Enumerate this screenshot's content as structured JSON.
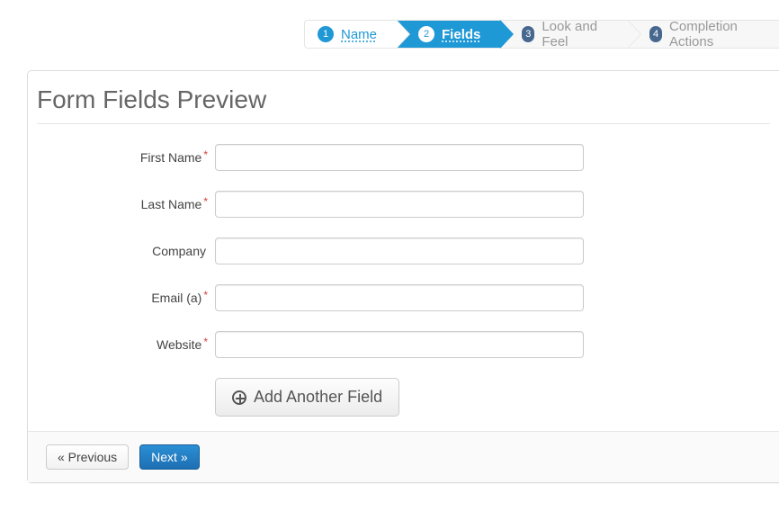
{
  "wizard": {
    "steps": [
      {
        "num": "1",
        "label": "Name"
      },
      {
        "num": "2",
        "label": "Fields"
      },
      {
        "num": "3",
        "label": "Look and Feel"
      },
      {
        "num": "4",
        "label": "Completion Actions"
      }
    ]
  },
  "panel": {
    "title": "Form Fields Preview"
  },
  "fields": [
    {
      "label": "First Name",
      "required": true,
      "value": ""
    },
    {
      "label": "Last Name",
      "required": true,
      "value": ""
    },
    {
      "label": "Company",
      "required": false,
      "value": ""
    },
    {
      "label": "Email (a)",
      "required": true,
      "value": ""
    },
    {
      "label": "Website",
      "required": true,
      "value": ""
    }
  ],
  "buttons": {
    "add_field": "Add Another Field",
    "previous": "« Previous",
    "next": "Next »"
  }
}
